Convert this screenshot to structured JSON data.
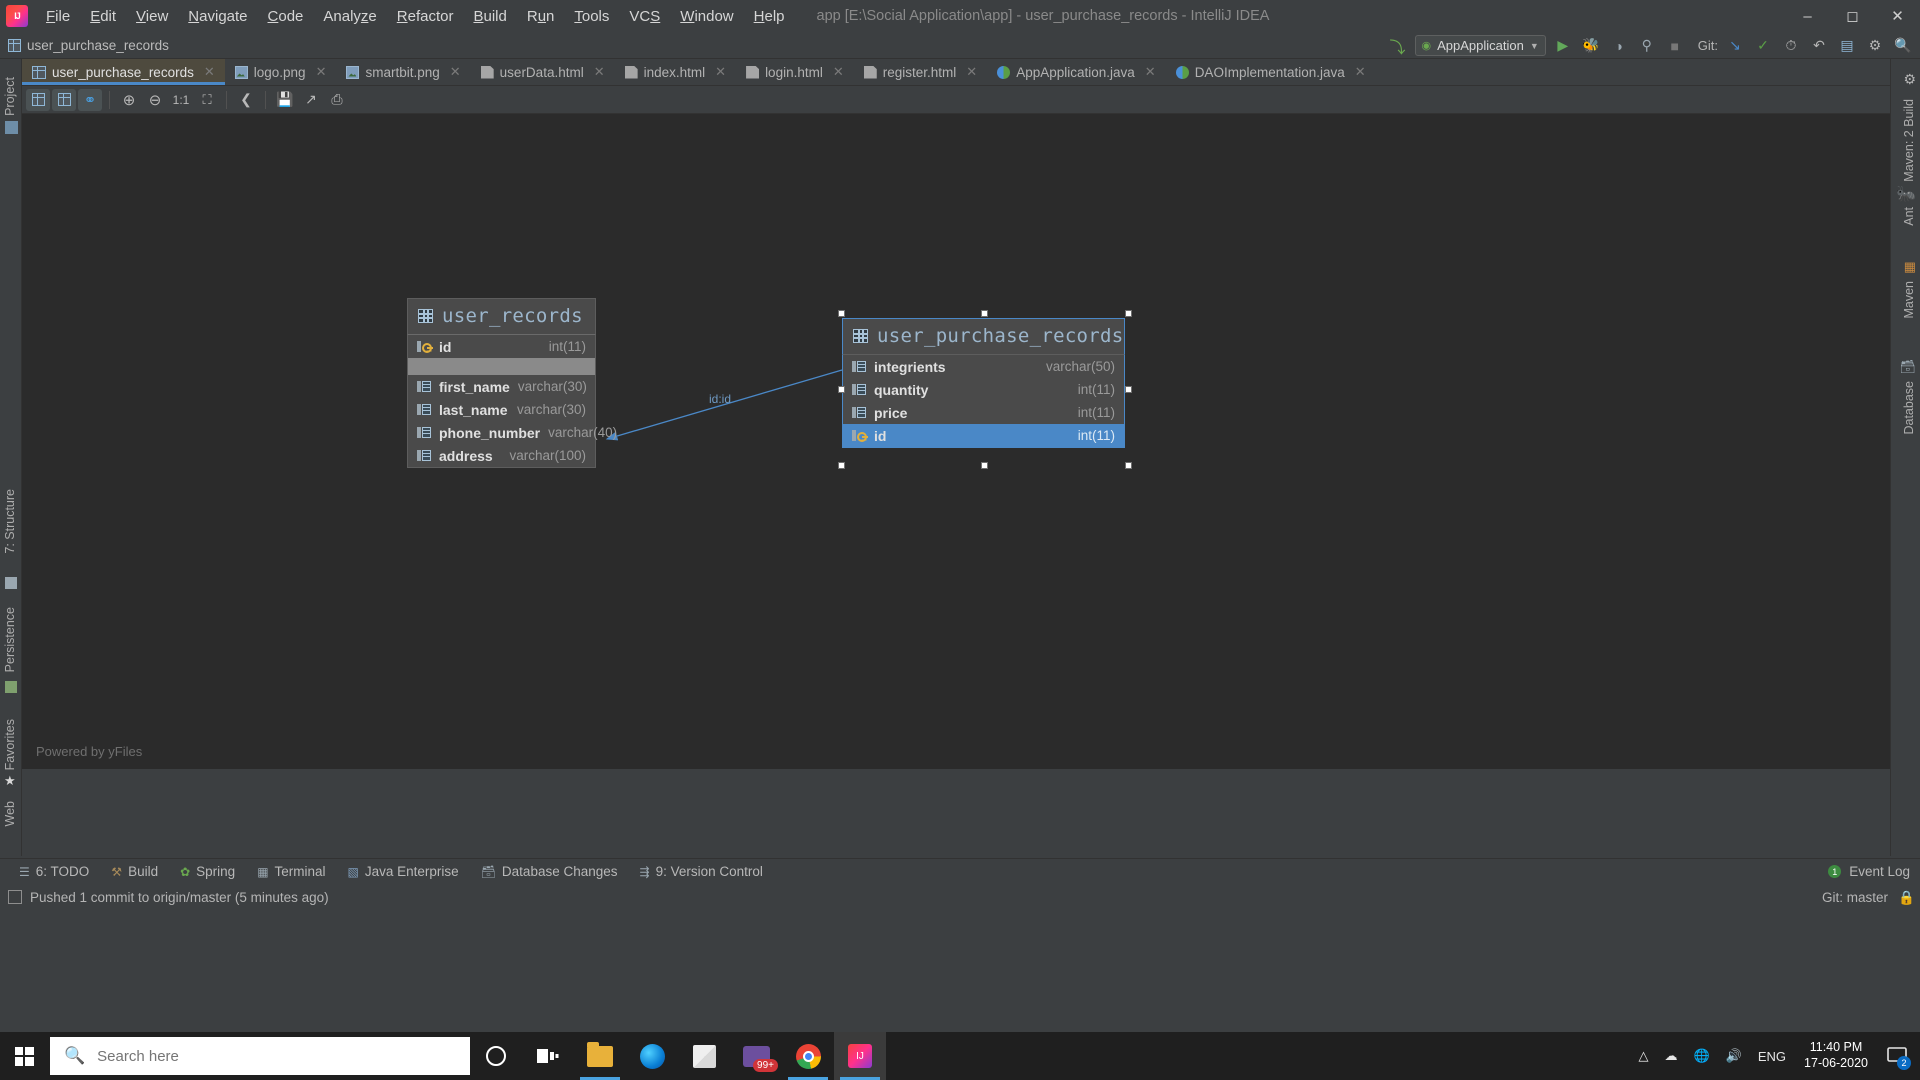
{
  "window": {
    "title": "app [E:\\Social Application\\app] - user_purchase_records - IntelliJ IDEA",
    "minimize": "–",
    "maximize": "☐",
    "close": "✕"
  },
  "menu": {
    "items": [
      {
        "label": "File",
        "mnemonic": "F"
      },
      {
        "label": "Edit",
        "mnemonic": "E"
      },
      {
        "label": "View",
        "mnemonic": "V"
      },
      {
        "label": "Navigate",
        "mnemonic": "N"
      },
      {
        "label": "Code",
        "mnemonic": "C"
      },
      {
        "label": "Analyze",
        "mnemonic": "z"
      },
      {
        "label": "Refactor",
        "mnemonic": "R"
      },
      {
        "label": "Build",
        "mnemonic": "B"
      },
      {
        "label": "Run",
        "mnemonic": "u"
      },
      {
        "label": "Tools",
        "mnemonic": "T"
      },
      {
        "label": "VCS",
        "mnemonic": "S"
      },
      {
        "label": "Window",
        "mnemonic": "W"
      },
      {
        "label": "Help",
        "mnemonic": "H"
      }
    ]
  },
  "navbar": {
    "breadcrumb": "user_purchase_records"
  },
  "runbar": {
    "config_name": "AppApplication",
    "git_label": "Git:",
    "run_icon": "▶",
    "debug_icon": "🐞",
    "coverage_icon": "◑",
    "profile_icon": "⌕",
    "stop_icon": "■",
    "update_icon": "↙",
    "commit_icon": "✓",
    "history_icon": "◷",
    "rollback_icon": "↶",
    "hammer_icon": "⚒",
    "search_icon": "🔍",
    "settings_icon": "⚙"
  },
  "tabs": [
    {
      "label": "user_purchase_records",
      "icon": "diagram-icon",
      "active": true
    },
    {
      "label": "logo.png",
      "icon": "image-icon",
      "active": false
    },
    {
      "label": "smartbit.png",
      "icon": "image-icon",
      "active": false
    },
    {
      "label": "userData.html",
      "icon": "html-icon",
      "active": false
    },
    {
      "label": "index.html",
      "icon": "html-icon",
      "active": false
    },
    {
      "label": "login.html",
      "icon": "html-icon",
      "active": false
    },
    {
      "label": "register.html",
      "icon": "html-icon",
      "active": false
    },
    {
      "label": "AppApplication.java",
      "icon": "java-icon",
      "active": false
    },
    {
      "label": "DAOImplementation.java",
      "icon": "java-icon",
      "active": false
    }
  ],
  "diagram_toolbar": {
    "buttons": [
      {
        "name": "show-columns-button",
        "glyph": "▤",
        "selected": true
      },
      {
        "name": "show-keys-button",
        "glyph": "▥",
        "selected": false
      },
      {
        "name": "show-indices-button",
        "glyph": "⚿",
        "selected": true
      },
      {
        "name": "zoom-in-button",
        "glyph": "⊕",
        "selected": false
      },
      {
        "name": "zoom-out-button",
        "glyph": "⊖",
        "selected": false
      },
      {
        "name": "actual-size-button",
        "glyph": "1:1",
        "selected": false
      },
      {
        "name": "fit-content-button",
        "glyph": "⛶",
        "selected": false
      },
      {
        "name": "layout-button",
        "glyph": "≪",
        "selected": false
      },
      {
        "name": "save-diagram-button",
        "glyph": "💾",
        "selected": false
      },
      {
        "name": "export-button",
        "glyph": "↗",
        "selected": false
      },
      {
        "name": "print-button",
        "glyph": "⎙",
        "selected": false
      }
    ]
  },
  "left_strip": {
    "items": [
      {
        "label": "Project",
        "icon": "project-icon"
      },
      {
        "label": "7: Structure",
        "icon": "structure-icon"
      },
      {
        "label": "Persistence",
        "icon": "persistence-icon"
      },
      {
        "label": "Favorites",
        "icon": "star-icon"
      },
      {
        "label": "Web",
        "icon": "web-icon"
      }
    ]
  },
  "right_strip": {
    "items": [
      {
        "label": "Maven: 2 Build",
        "icon": "maven-icon"
      },
      {
        "label": "Ant",
        "icon": "ant-icon"
      },
      {
        "label": "Maven",
        "icon": "maven-icon"
      },
      {
        "label": "Database",
        "icon": "database-icon"
      }
    ]
  },
  "canvas": {
    "powered_by": "Powered by yFiles",
    "edge_label": "id:id"
  },
  "diagram": {
    "tables": [
      {
        "name": "user_records",
        "selected": false,
        "columns": [
          {
            "name": "id",
            "type": "int(11)",
            "primary_key": true,
            "selected": false
          },
          {
            "name": "first_name",
            "type": "varchar(30)",
            "primary_key": false,
            "selected": false
          },
          {
            "name": "last_name",
            "type": "varchar(30)",
            "primary_key": false,
            "selected": false
          },
          {
            "name": "phone_number",
            "type": "varchar(40)",
            "primary_key": false,
            "selected": false
          },
          {
            "name": "address",
            "type": "varchar(100)",
            "primary_key": false,
            "selected": false
          }
        ]
      },
      {
        "name": "user_purchase_records",
        "selected": true,
        "columns": [
          {
            "name": "integrients",
            "type": "varchar(50)",
            "primary_key": false,
            "selected": false
          },
          {
            "name": "quantity",
            "type": "int(11)",
            "primary_key": false,
            "selected": false
          },
          {
            "name": "price",
            "type": "int(11)",
            "primary_key": false,
            "selected": false
          },
          {
            "name": "id",
            "type": "int(11)",
            "primary_key": true,
            "selected": true
          }
        ]
      }
    ]
  },
  "bottom_bar": {
    "items": [
      {
        "label": "6: TODO",
        "underline": "6",
        "icon": "todo-icon"
      },
      {
        "label": "Build",
        "underline": "",
        "icon": "build-icon"
      },
      {
        "label": "Spring",
        "underline": "",
        "icon": "spring-icon"
      },
      {
        "label": "Terminal",
        "underline": "",
        "icon": "terminal-icon"
      },
      {
        "label": "Java Enterprise",
        "underline": "",
        "icon": "java-enterprise-icon"
      },
      {
        "label": "Database Changes",
        "underline": "",
        "icon": "database-changes-icon"
      },
      {
        "label": "9: Version Control",
        "underline": "9",
        "icon": "version-control-icon"
      }
    ],
    "event_log": "Event Log",
    "event_badge": "1"
  },
  "statusbar": {
    "message": "Pushed 1 commit to origin/master (5 minutes ago)",
    "branch": "Git: master"
  },
  "taskbar": {
    "search_placeholder": "Search here",
    "search_value": "",
    "mail_badge": "99+",
    "notification_badge": "2",
    "language": "ENG",
    "time": "11:40 PM",
    "date": "17-06-2020",
    "apps": [
      {
        "name": "cortana-button",
        "icon": "cortana-icon"
      },
      {
        "name": "task-view-button",
        "icon": "task-view-icon"
      },
      {
        "name": "file-explorer-button",
        "icon": "folder-icon"
      },
      {
        "name": "edge-button",
        "icon": "edge-icon"
      },
      {
        "name": "microsoft-store-button",
        "icon": "store-icon"
      },
      {
        "name": "mail-button",
        "icon": "mail-icon"
      },
      {
        "name": "chrome-button",
        "icon": "chrome-icon"
      },
      {
        "name": "intellij-button",
        "icon": "intellij-icon"
      }
    ]
  },
  "colors": {
    "accent": "#4a88c7",
    "background": "#3c3f41",
    "canvas": "#2b2b2b",
    "table_header": "#4a4a4a",
    "key_yellow": "#e2b03c"
  }
}
